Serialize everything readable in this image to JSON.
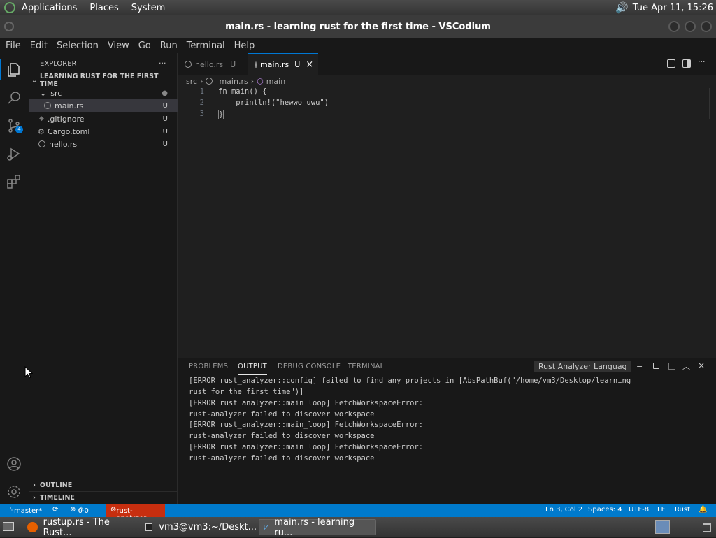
{
  "top_panel": {
    "menus": [
      "Applications",
      "Places",
      "System"
    ],
    "clock": "Tue Apr 11, 15:26"
  },
  "window": {
    "title": "main.rs - learning rust for the first time - VSCodium"
  },
  "menubar": [
    "File",
    "Edit",
    "Selection",
    "View",
    "Go",
    "Run",
    "Terminal",
    "Help"
  ],
  "activity": {
    "scm_badge": "4"
  },
  "explorer": {
    "title": "EXPLORER",
    "more": "···",
    "project": "LEARNING RUST FOR THE FIRST TIME",
    "items": [
      {
        "name": "src",
        "badge": "●"
      },
      {
        "name": "main.rs",
        "badge": "U"
      },
      {
        "name": ".gitignore",
        "badge": "U"
      },
      {
        "name": "Cargo.toml",
        "badge": "U"
      },
      {
        "name": "hello.rs",
        "badge": "U"
      }
    ],
    "outline": "OUTLINE",
    "timeline": "TIMELINE"
  },
  "tabs": [
    {
      "label": "hello.rs",
      "badge": "U"
    },
    {
      "label": "main.rs",
      "badge": "U",
      "close": "×"
    }
  ],
  "breadcrumb": [
    "src",
    "main.rs",
    "main"
  ],
  "code": {
    "lines": [
      {
        "n": "1",
        "text": "fn main() {"
      },
      {
        "n": "2",
        "text": "    println!(\"hewwo uwu\")"
      },
      {
        "n": "3",
        "text": "}"
      }
    ]
  },
  "panel": {
    "tabs": [
      "PROBLEMS",
      "OUTPUT",
      "DEBUG CONSOLE",
      "TERMINAL"
    ],
    "channel": "Rust Analyzer Languag",
    "output": [
      "[ERROR rust_analyzer::config] failed to find any projects in [AbsPathBuf(\"/home/vm3/Desktop/learning",
      "rust for the first time\")]",
      "[ERROR rust_analyzer::main_loop] FetchWorkspaceError:",
      "rust-analyzer failed to discover workspace",
      "[ERROR rust_analyzer::main_loop] FetchWorkspaceError:",
      "rust-analyzer failed to discover workspace",
      "[ERROR rust_analyzer::main_loop] FetchWorkspaceError:",
      "rust-analyzer failed to discover workspace"
    ]
  },
  "status": {
    "branch": "master*",
    "errors": "0",
    "warnings": "0",
    "analyzer": "rust-analyzer",
    "position": "Ln 3, Col 2",
    "spaces": "Spaces: 4",
    "encoding": "UTF-8",
    "eol": "LF",
    "language": "Rust"
  },
  "taskbar": [
    "rustup.rs - The Rust...",
    "vm3@vm3:~/Deskt...",
    "main.rs - learning ru..."
  ],
  "colors": {
    "accent": "#007acc",
    "analyzer_error": "#c72e0f"
  }
}
